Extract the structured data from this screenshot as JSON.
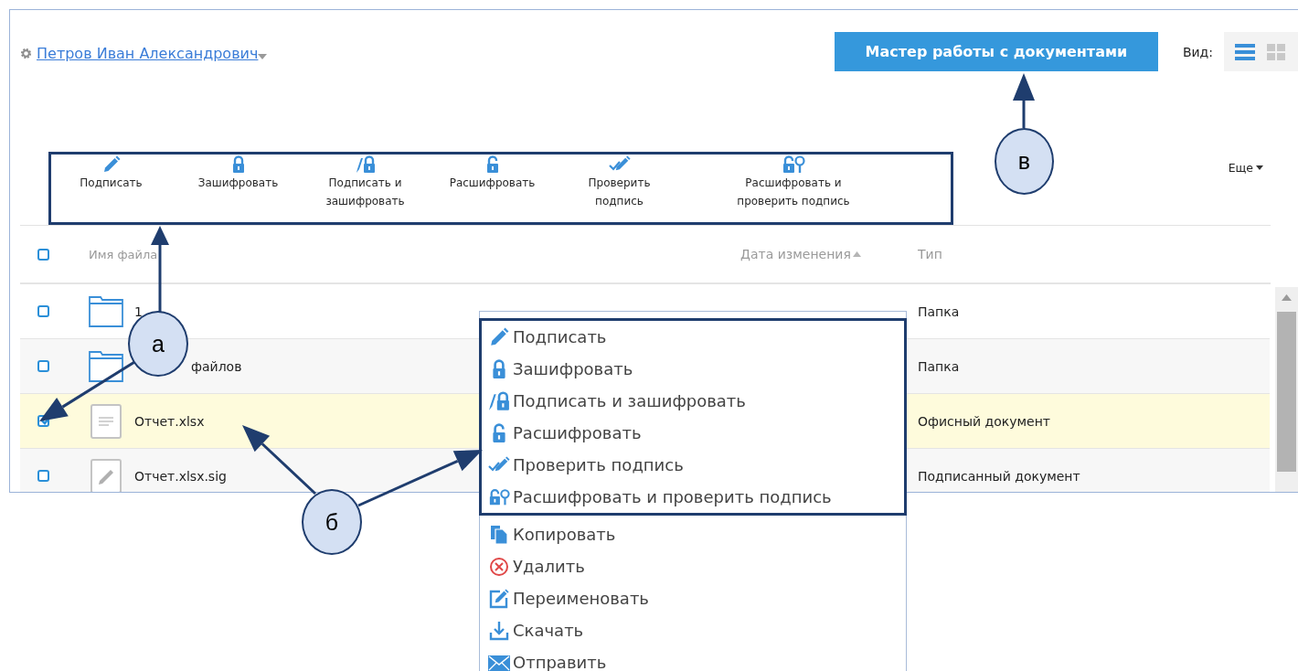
{
  "user": {
    "name": "Петров Иван Александрович"
  },
  "wizard_button": {
    "label": "Мастер работы с документами"
  },
  "view": {
    "label": "Вид:",
    "modes": [
      {
        "kind": "list",
        "selected": true
      },
      {
        "kind": "grid",
        "selected": false
      }
    ]
  },
  "toolbar": {
    "highlighted": true,
    "actions": [
      {
        "kind": "sign",
        "label": "Подписать"
      },
      {
        "kind": "encrypt",
        "label": "Зашифровать"
      },
      {
        "kind": "sign_encrypt",
        "label": "Подписать и зашифровать"
      },
      {
        "kind": "decrypt",
        "label": "Расшифровать"
      },
      {
        "kind": "verify",
        "label": "Проверить подпись"
      },
      {
        "kind": "decrypt_verify",
        "label": "Расшифровать и проверить подпись"
      }
    ],
    "more": "Еще"
  },
  "table": {
    "header_checked": false,
    "columns": [
      {
        "label": "Имя файла",
        "sorted": false
      },
      {
        "label": "Дата изменения",
        "sorted": true
      },
      {
        "label": "Тип",
        "sorted": false
      }
    ],
    "rows": [
      {
        "kind": "folder",
        "name": "1",
        "type": "Папка",
        "checked": false
      },
      {
        "kind": "folder",
        "name": "файлов",
        "type": "Папка",
        "checked": false
      },
      {
        "kind": "document",
        "name": "Отчет.xlsx",
        "type": "Офисный документ",
        "checked": true
      },
      {
        "kind": "signature",
        "name": "Отчет.xlsx.sig",
        "type": "Подписанный документ",
        "checked": false
      }
    ]
  },
  "context_menu": {
    "items": [
      {
        "kind": "sign",
        "label": "Подписать",
        "highlighted": true
      },
      {
        "kind": "encrypt",
        "label": "Зашифровать",
        "highlighted": true
      },
      {
        "kind": "sign_encrypt",
        "label": "Подписать и зашифровать",
        "highlighted": true
      },
      {
        "kind": "decrypt",
        "label": "Расшифровать",
        "highlighted": true
      },
      {
        "kind": "verify",
        "label": "Проверить подпись",
        "highlighted": true
      },
      {
        "kind": "decrypt_verify",
        "label": "Расшифровать и проверить подпись",
        "highlighted": true
      },
      {
        "kind": "copy",
        "label": "Копировать",
        "highlighted": false
      },
      {
        "kind": "delete",
        "label": "Удалить",
        "highlighted": false
      },
      {
        "kind": "rename",
        "label": "Переименовать",
        "highlighted": false
      },
      {
        "kind": "download",
        "label": "Скачать",
        "highlighted": false
      },
      {
        "kind": "send",
        "label": "Отправить",
        "highlighted": false
      }
    ]
  },
  "callouts": [
    {
      "label": "а"
    },
    {
      "label": "б"
    },
    {
      "label": "в"
    }
  ]
}
